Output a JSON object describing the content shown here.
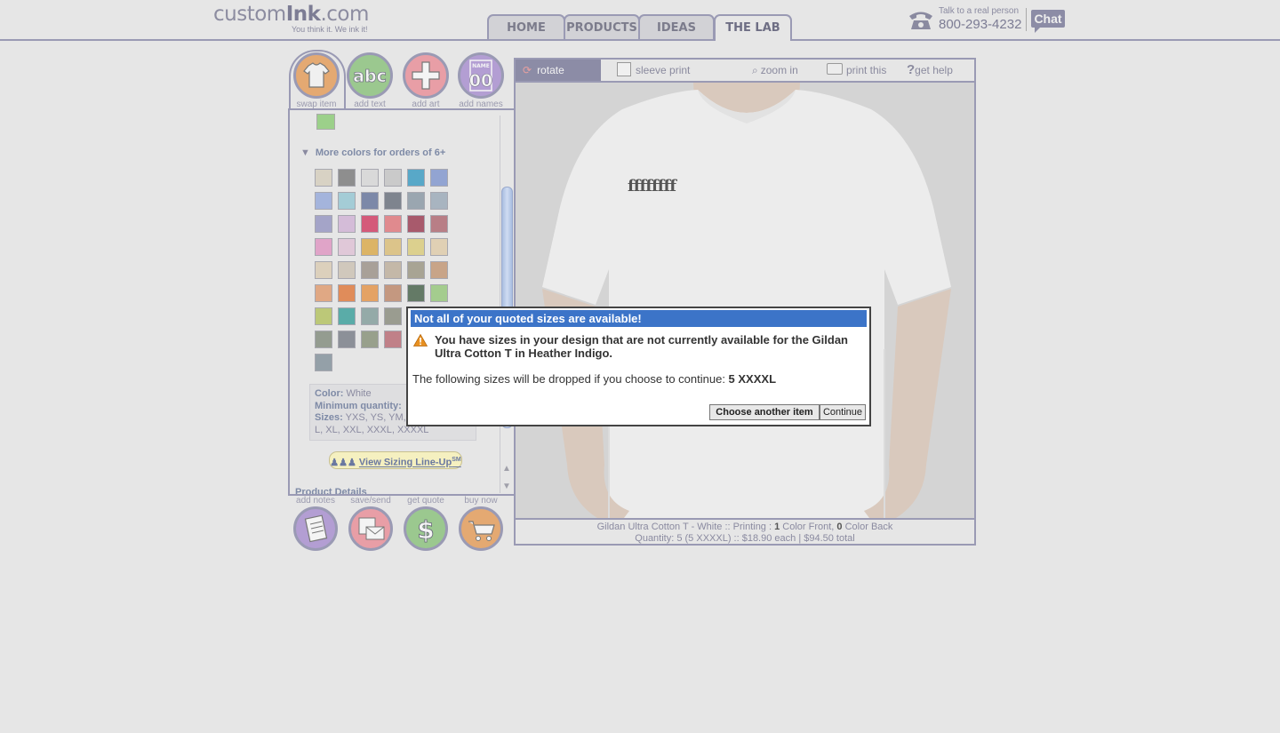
{
  "header": {
    "logo_text_light": "custom",
    "logo_text_bold": "Ink",
    "logo_text_suffix": ".com",
    "tagline": "You think it. We ink it!",
    "nav_tabs": [
      {
        "label": "HOME",
        "active": false
      },
      {
        "label": "PRODUCTS",
        "active": false
      },
      {
        "label": "IDEAS",
        "active": false
      },
      {
        "label": "THE LAB",
        "active": true
      }
    ],
    "phone_talk": "Talk to a real person",
    "phone_number": "800-293-4232",
    "chat_label": "Chat"
  },
  "tools": {
    "top": [
      {
        "label": "swap item",
        "icon": "tshirt-icon",
        "color": "#e4a972"
      },
      {
        "label": "add text",
        "icon": "abc-icon",
        "color": "#9bc88f"
      },
      {
        "label": "add art",
        "icon": "plus-art-icon",
        "color": "#e89ea6"
      },
      {
        "label": "add names",
        "icon": "name-number-icon",
        "color": "#b39ed3",
        "icon_text_small": "NAME",
        "icon_text_big": "00"
      }
    ],
    "bottom": [
      {
        "label": "add notes",
        "icon": "notepad-icon",
        "color": "#b39ed3"
      },
      {
        "label": "save/send",
        "icon": "save-envelope-icon",
        "color": "#e89ea6"
      },
      {
        "label": "get quote",
        "icon": "dollar-icon",
        "color": "#9bc88f",
        "icon_text": "$"
      },
      {
        "label": "buy now",
        "icon": "shopping-cart-icon",
        "color": "#e4a972"
      }
    ]
  },
  "color_panel": {
    "more_colors_label": "More colors for orders of 6+",
    "top_swatch": "#9cd08a",
    "swatches": [
      "#d8d2c4",
      "#8e8e8e",
      "#d9d9d9",
      "#cacaca",
      "#58a8c8",
      "#92a4d2",
      "#a4b4dc",
      "#a4ccd6",
      "#7c88a8",
      "#7e848e",
      "#9aa6b0",
      "#a8b4c0",
      "#a4a4c8",
      "#d4bcd8",
      "#d45a7a",
      "#e08a8e",
      "#a85a6c",
      "#b87e86",
      "#e0a4c8",
      "#e0c8d8",
      "#dcb466",
      "#dcc48a",
      "#dcd08e",
      "#e0d0b4",
      "#dcd0bc",
      "#d0c8bc",
      "#a8a098",
      "#c4b8a8",
      "#a8a494",
      "#c8a488",
      "#e0a884",
      "#e08c5a",
      "#e4a264",
      "#c49880",
      "#647a66",
      "#a4cc8e",
      "#bcc878",
      "#5aaca8",
      "#94aaa8",
      "#9a9c90",
      "#000000",
      "#000000",
      "#949c90",
      "#8c9098",
      "#98a08c",
      "#c08088",
      "#000000",
      "#000000",
      "#94a0a8"
    ],
    "info": {
      "color_label": "Color:",
      "color_value": "White",
      "min_qty_label": "Minimum quantity:",
      "min_qty_value": "",
      "sizes_label": "Sizes:",
      "sizes_value_line1": "YXS, YS, YM, ",
      "sizes_value_line2": "L, XL, XXL, XXXL, XXXXL"
    },
    "sizing_button": "View Sizing Line-Up",
    "sizing_button_sup": "SM",
    "product_details_label": "Product Details"
  },
  "design_toolbar": {
    "rotate": "rotate",
    "sleeve_print": "sleeve print",
    "zoom_in": "zoom in",
    "print_this": "print this",
    "get_help": "get help"
  },
  "design_text": "ffffffff",
  "summary": {
    "line1_prefix": "Gildan Ultra Cotton T - White :: Printing : ",
    "front_count": "1",
    "line1_mid": " Color Front, ",
    "back_count": "0",
    "line1_suffix": " Color Back",
    "line2": "Quantity: 5 (5 XXXXL) :: $18.90 each | $94.50 total"
  },
  "dialog": {
    "title": "Not all of your quoted sizes are available!",
    "message": "You have sizes in your design that are not currently available for the Gildan Ultra Cotton T in Heather Indigo.",
    "drop_text": "The following sizes will be dropped if you choose to continue: ",
    "drop_sizes": "5 XXXXL",
    "choose_label": "Choose another item",
    "continue_label": "Continue"
  }
}
